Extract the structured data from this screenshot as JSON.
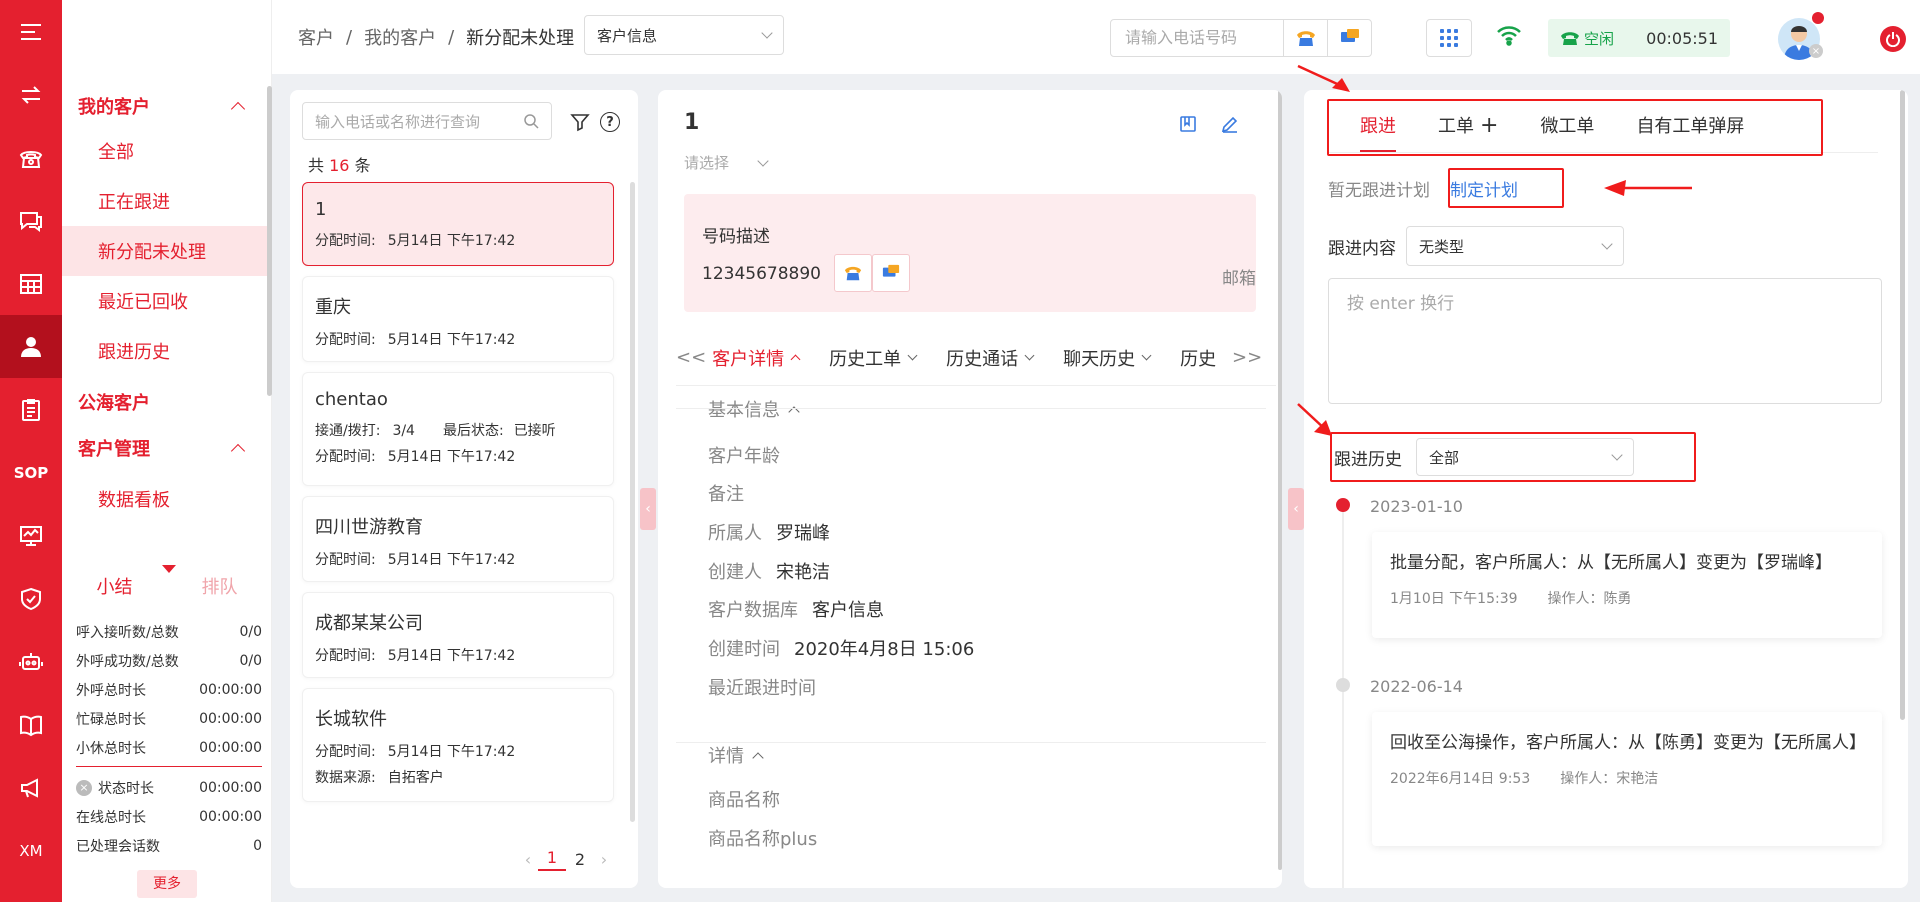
{
  "rail": {
    "sop_label": "SOP",
    "xm_label": "XM"
  },
  "sidebar": {
    "group_my": "我的客户",
    "items": [
      "全部",
      "正在跟进",
      "新分配未处理",
      "最近已回收",
      "跟进历史"
    ],
    "group_public": "公海客户",
    "group_manage": "客户管理",
    "manage_items": [
      "数据看板"
    ]
  },
  "stats": {
    "tab_summary": "小结",
    "tab_queue": "排队",
    "rows": [
      {
        "label": "呼入接听数/总数",
        "value": "0/0"
      },
      {
        "label": "外呼成功数/总数",
        "value": "0/0"
      },
      {
        "label": "外呼总时长",
        "value": "00:00:00"
      },
      {
        "label": "忙碌总时长",
        "value": "00:00:00"
      },
      {
        "label": "小休总时长",
        "value": "00:00:00"
      }
    ],
    "rows2": [
      {
        "label": "状态时长",
        "value": "00:00:00"
      },
      {
        "label": "在线总时长",
        "value": "00:00:00"
      },
      {
        "label": "已处理会话数",
        "value": "0"
      }
    ],
    "more": "更多"
  },
  "header": {
    "breadcrumb": [
      "客户",
      "我的客户",
      "新分配未处理"
    ],
    "breadcrumb_sep": "/",
    "db_select": "客户信息",
    "phone_placeholder": "请输入电话号码",
    "status": "空闲",
    "timer": "00:05:51"
  },
  "list": {
    "search_placeholder": "输入电话或名称进行查询",
    "count_prefix": "共",
    "count": "16",
    "count_suffix": "条",
    "cards": [
      {
        "name": "1",
        "assign_label": "分配时间:",
        "assign_time": "5月14日 下午17:42"
      },
      {
        "name": "重庆",
        "assign_label": "分配时间:",
        "assign_time": "5月14日 下午17:42"
      },
      {
        "name": "chentao",
        "calls_label": "接通/拨打:",
        "calls": "3/4",
        "last_label": "最后状态:",
        "last": "已接听",
        "assign_label": "分配时间:",
        "assign_time": "5月14日 下午17:42"
      },
      {
        "name": "四川世游教育",
        "assign_label": "分配时间:",
        "assign_time": "5月14日 下午17:42"
      },
      {
        "name": "成都某某公司",
        "assign_label": "分配时间:",
        "assign_time": "5月14日 下午17:42"
      },
      {
        "name": "长城软件",
        "assign_label": "分配时间:",
        "assign_time": "5月14日 下午17:42",
        "source_label": "数据来源:",
        "source": "自拓客户"
      }
    ],
    "pages": [
      "1",
      "2"
    ]
  },
  "detail": {
    "name": "1",
    "select_placeholder": "请选择",
    "phone_title": "号码描述",
    "phone": "12345678890",
    "email_label": "邮箱",
    "tabs_left": "<<",
    "tabs": [
      "客户详情",
      "历史工单",
      "历史通话",
      "聊天历史",
      "历史"
    ],
    "tabs_right": ">>",
    "section_basic": "基本信息",
    "fields": [
      {
        "label": "客户年龄",
        "value": ""
      },
      {
        "label": "备注",
        "value": ""
      },
      {
        "label": "所属人",
        "value": "罗瑞峰"
      },
      {
        "label": "创建人",
        "value": "宋艳洁"
      },
      {
        "label": "客户数据库",
        "value": "客户信息"
      },
      {
        "label": "创建时间",
        "value": "2020年4月8日 15:06"
      },
      {
        "label": "最近跟进时间",
        "value": ""
      }
    ],
    "section_detail": "详情",
    "detail_fields": [
      {
        "label": "商品名称",
        "value": ""
      },
      {
        "label": "商品名称plus",
        "value": ""
      }
    ]
  },
  "follow": {
    "tabs": [
      "跟进",
      "工单",
      "微工单",
      "自有工单弹屏"
    ],
    "no_plan": "暂无跟进计划",
    "make_plan": "制定计划",
    "content_label": "跟进内容",
    "content_type": "无类型",
    "textarea_placeholder": "按 enter 换行",
    "history_label": "跟进历史",
    "history_filter": "全部",
    "timeline": [
      {
        "date": "2023-01-10",
        "content": "批量分配，客户所属人：从【无所属人】变更为【罗瑞峰】",
        "time": "1月10日 下午15:39",
        "operator": "操作人：陈勇"
      },
      {
        "date": "2022-06-14",
        "content": "回收至公海操作，客户所属人：从【陈勇】变更为【无所属人】",
        "time": "2022年6月14日 9:53",
        "operator": "操作人：宋艳洁"
      }
    ]
  },
  "colors": {
    "brand": "#e4202f",
    "link": "#3a7be0",
    "status_green": "#17a34a",
    "annotation": "#f01c1c"
  }
}
